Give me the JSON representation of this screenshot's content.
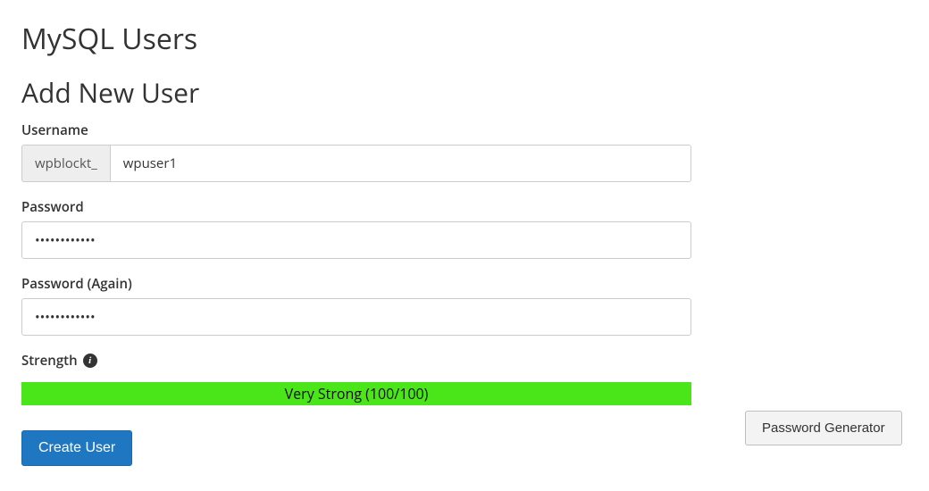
{
  "section_title": "MySQL Users",
  "subsection_title": "Add New User",
  "form": {
    "username_label": "Username",
    "username_prefix": "wpblockt_",
    "username_value": "wpuser1",
    "password_label": "Password",
    "password_value": "••••••••••••",
    "password_again_label": "Password (Again)",
    "password_again_value": "••••••••••••",
    "strength_label": "Strength",
    "strength_text": "Very Strong (100/100)",
    "strength_color": "#4ae619",
    "create_button": "Create User",
    "generator_button": "Password Generator"
  }
}
